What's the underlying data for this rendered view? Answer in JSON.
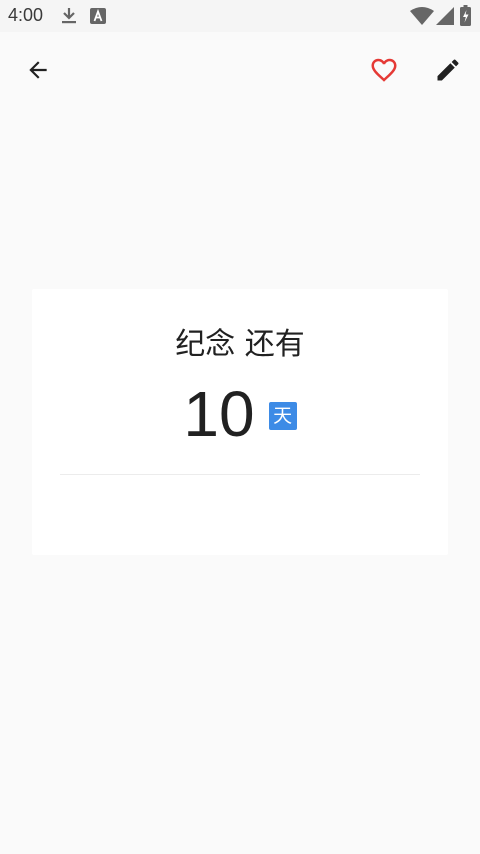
{
  "status_bar": {
    "time": "4:00",
    "icons": [
      "download-icon",
      "text-a-icon",
      "wifi-icon",
      "signal-icon",
      "battery-icon"
    ]
  },
  "toolbar": {
    "icons": [
      "back-arrow-icon",
      "heart-outline-icon",
      "edit-pencil-icon"
    ],
    "heart_color": "#e53935"
  },
  "card": {
    "title": "纪念 还有",
    "count": "10",
    "unit": "天",
    "unit_color": "#3d8be6"
  }
}
